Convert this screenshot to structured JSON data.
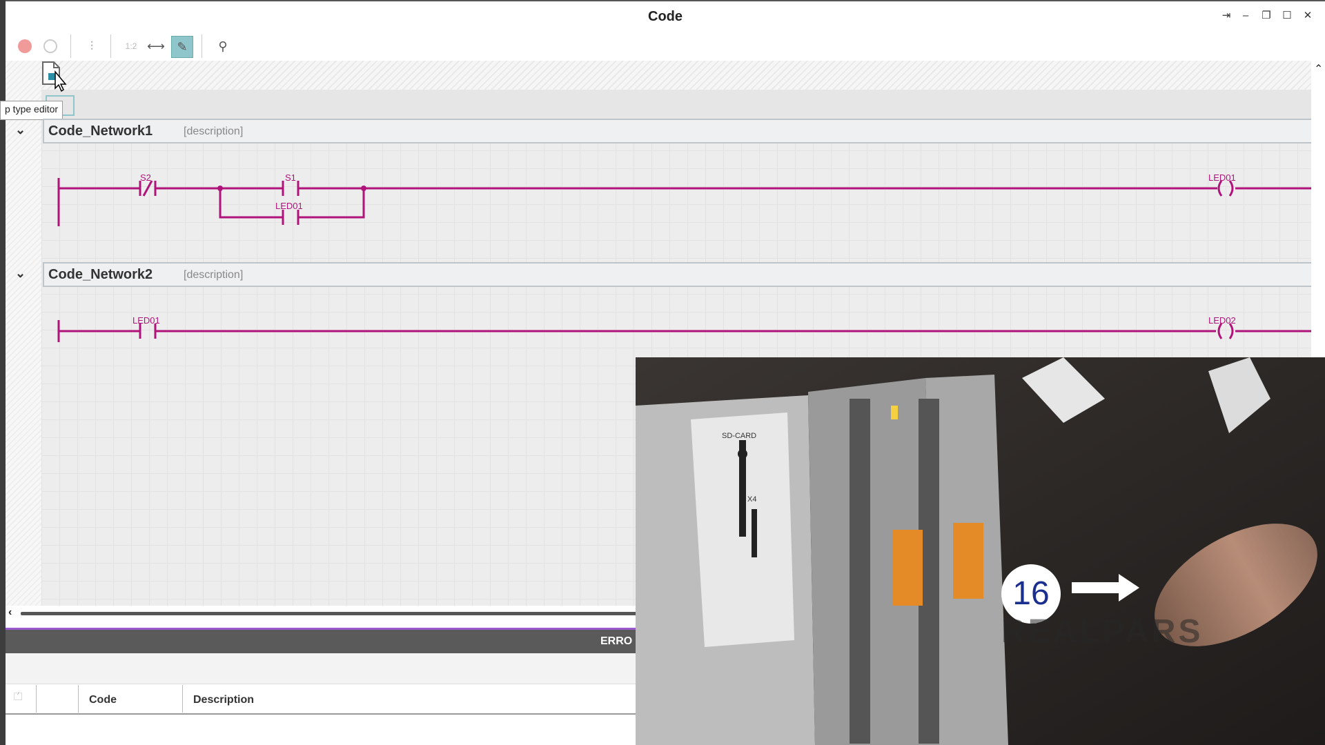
{
  "window": {
    "title": "Code"
  },
  "tooltip": "p type editor",
  "networks": [
    {
      "name": "Code_Network1",
      "description": "[description]"
    },
    {
      "name": "Code_Network2",
      "description": "[description]"
    }
  ],
  "ladder": {
    "n1": {
      "c1": "S2",
      "c2": "S1",
      "c3": "LED01",
      "coil": "LED01"
    },
    "n2": {
      "c1": "LED01",
      "coil": "LED02"
    }
  },
  "toolbar": {
    "zoom_label": "1:2"
  },
  "errors": {
    "title": "ERRO",
    "columns": [
      "Code",
      "Description"
    ]
  },
  "video": {
    "step": "16",
    "watermark": "REALPARS",
    "sd_label": "SD-CARD",
    "x4_label": "X4"
  },
  "colors": {
    "ladder": "#b0147a",
    "accent": "#9b59d0"
  }
}
